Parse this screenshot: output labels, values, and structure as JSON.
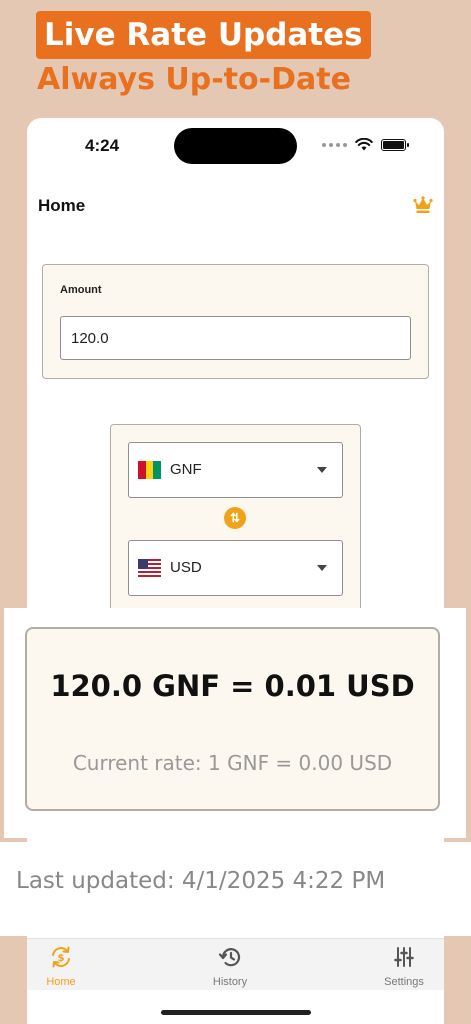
{
  "promo": {
    "title": "Live Rate Updates",
    "subtitle": "Always Up-to-Date"
  },
  "status_bar": {
    "time": "4:24"
  },
  "nav": {
    "title": "Home",
    "premium_icon": "crown-icon"
  },
  "amount": {
    "label": "Amount",
    "value": "120.0"
  },
  "from_currency": {
    "code": "GNF",
    "flag": "guinea-flag"
  },
  "to_currency": {
    "code": "USD",
    "flag": "us-flag"
  },
  "swap_icon": "swap-vertical-icon",
  "result": {
    "conversion": "120.0 GNF = 0.01 USD",
    "rate": "Current rate: 1 GNF = 0.00 USD"
  },
  "last_updated": "Last updated: 4/1/2025 4:22 PM",
  "tabs": [
    {
      "label": "Home",
      "icon": "currency-exchange-icon",
      "active": true
    },
    {
      "label": "History",
      "icon": "history-icon",
      "active": false
    },
    {
      "label": "Settings",
      "icon": "sliders-icon",
      "active": false
    }
  ],
  "colors": {
    "background": "#e5c8b4",
    "accent": "#e8701e",
    "tab_active": "#f0a21a",
    "card": "#fdf8ef"
  }
}
